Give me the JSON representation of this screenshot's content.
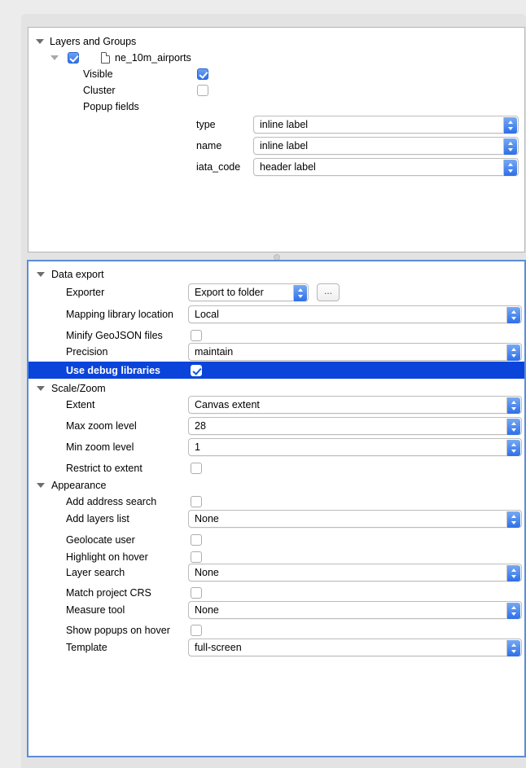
{
  "top_panel": {
    "group_label": "Layers and Groups",
    "layer": {
      "name": "ne_10m_airports",
      "checked": true
    },
    "properties": [
      {
        "label": "Visible",
        "checked": true
      },
      {
        "label": "Cluster",
        "checked": false
      },
      {
        "label": "Popup fields",
        "checked": null
      }
    ],
    "popup_fields": [
      {
        "field": "type",
        "value": "inline label"
      },
      {
        "field": "name",
        "value": "inline label"
      },
      {
        "field": "iata_code",
        "value": "header label"
      }
    ]
  },
  "bottom_panel": {
    "sections": [
      {
        "title": "Data export",
        "rows": [
          {
            "label": "Exporter",
            "type": "combo",
            "value": "Export to folder",
            "has_browse": true,
            "browse_label": "..."
          },
          {
            "label": "Mapping library location",
            "type": "combo",
            "value": "Local"
          },
          {
            "label": "Minify GeoJSON files",
            "type": "checkbox",
            "checked": false
          },
          {
            "label": "Precision",
            "type": "combo",
            "value": "maintain"
          },
          {
            "label": "Use debug libraries",
            "type": "checkbox",
            "checked": true,
            "selected": true
          }
        ]
      },
      {
        "title": "Scale/Zoom",
        "rows": [
          {
            "label": "Extent",
            "type": "combo",
            "value": "Canvas extent"
          },
          {
            "label": "Max zoom level",
            "type": "combo",
            "value": "28"
          },
          {
            "label": "Min zoom level",
            "type": "combo",
            "value": "1"
          },
          {
            "label": "Restrict to extent",
            "type": "checkbox",
            "checked": false
          }
        ]
      },
      {
        "title": "Appearance",
        "rows": [
          {
            "label": "Add address search",
            "type": "checkbox",
            "checked": false
          },
          {
            "label": "Add layers list",
            "type": "combo",
            "value": "None"
          },
          {
            "label": "Geolocate user",
            "type": "checkbox",
            "checked": false
          },
          {
            "label": "Highlight on hover",
            "type": "checkbox",
            "checked": false
          },
          {
            "label": "Layer search",
            "type": "combo",
            "value": "None"
          },
          {
            "label": "Match project CRS",
            "type": "checkbox",
            "checked": false
          },
          {
            "label": "Measure tool",
            "type": "combo",
            "value": "None"
          },
          {
            "label": "Show popups on hover",
            "type": "checkbox",
            "checked": false
          },
          {
            "label": "Template",
            "type": "combo",
            "value": "full-screen"
          }
        ]
      }
    ]
  },
  "colors": {
    "selection_blue": "#0b44db",
    "focus_border": "#5b8dd9",
    "checkbox_blue": "#2f72ec",
    "window_background": "#ececec",
    "panel_background": "#ffffff"
  }
}
